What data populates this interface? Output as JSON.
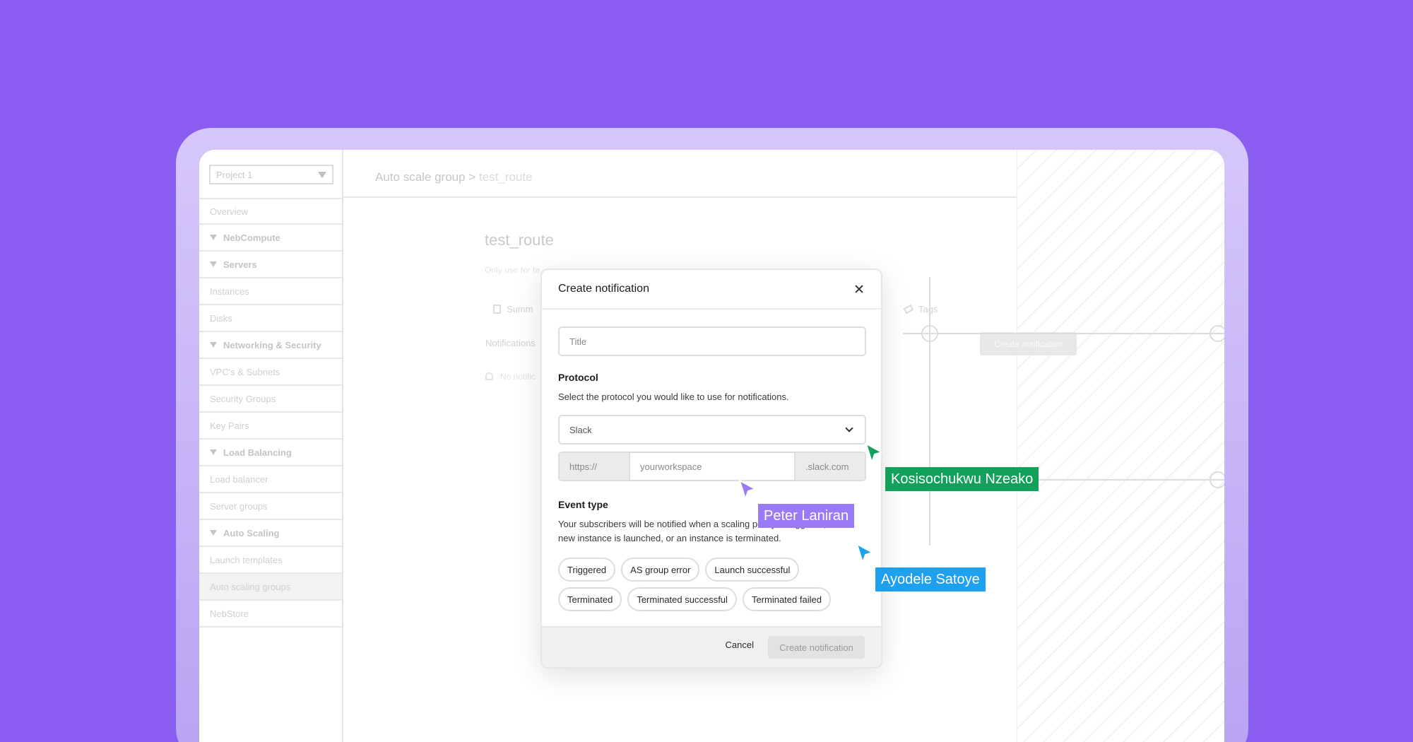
{
  "sidebar": {
    "project_select": "Project 1",
    "items": [
      {
        "label": "Overview",
        "type": "item"
      },
      {
        "label": "NebCompute",
        "type": "group"
      },
      {
        "label": "Servers",
        "type": "group"
      },
      {
        "label": "Instances",
        "type": "item"
      },
      {
        "label": "Disks",
        "type": "item"
      },
      {
        "label": "Networking & Security",
        "type": "group"
      },
      {
        "label": "VPC's & Subnets",
        "type": "item"
      },
      {
        "label": "Security Groups",
        "type": "item"
      },
      {
        "label": "Key Pairs",
        "type": "item"
      },
      {
        "label": "Load Balancing",
        "type": "group"
      },
      {
        "label": "Load balancer",
        "type": "item"
      },
      {
        "label": "Server groups",
        "type": "item"
      },
      {
        "label": "Auto Scaling",
        "type": "group"
      },
      {
        "label": "Launch templates",
        "type": "item"
      },
      {
        "label": "Auto scaling groups",
        "type": "item",
        "active": true
      },
      {
        "label": "NebStore",
        "type": "item"
      }
    ]
  },
  "header": {
    "breadcrumb_parent": "Auto scale group >",
    "breadcrumb_current": "test_route"
  },
  "page": {
    "title": "test_route",
    "subtitle": "Only use for te",
    "tab_summary": "Summ",
    "tab_tags": "Tags",
    "notifications_label": "Notifications",
    "no_notifications": "No notific",
    "create_button": "Create notification"
  },
  "modal": {
    "title": "Create notification",
    "title_placeholder": "Title",
    "protocol_heading": "Protocol",
    "protocol_desc": "Select the protocol you would like to use for notifications.",
    "protocol_value": "Slack",
    "url_prefix": "https://",
    "url_placeholder": "yourworkspace",
    "url_suffix": ".slack.com",
    "event_heading": "Event type",
    "event_desc_1": "Your subscribers will be notified when a scaling policy is triggered, a",
    "event_desc_2": "new instance is launched, or an instance is terminated.",
    "event_chips_row1": [
      "Triggered",
      "AS group error",
      "Launch successful"
    ],
    "event_chips_row2": [
      "Terminated",
      "Terminated successful",
      "Terminated failed"
    ],
    "cancel_label": "Cancel",
    "create_label": "Create notification"
  },
  "collaborators": [
    {
      "name": "Kosisochukwu Nzeako",
      "color": "#13a05a"
    },
    {
      "name": "Peter Laniran",
      "color": "#9b7bf5"
    },
    {
      "name": "Ayodele Satoye",
      "color": "#1ea0ee"
    }
  ],
  "colors": {
    "background": "#8b5cf0",
    "modal_bg": "#ffffff",
    "disabled_button": "#e2e2e2"
  }
}
